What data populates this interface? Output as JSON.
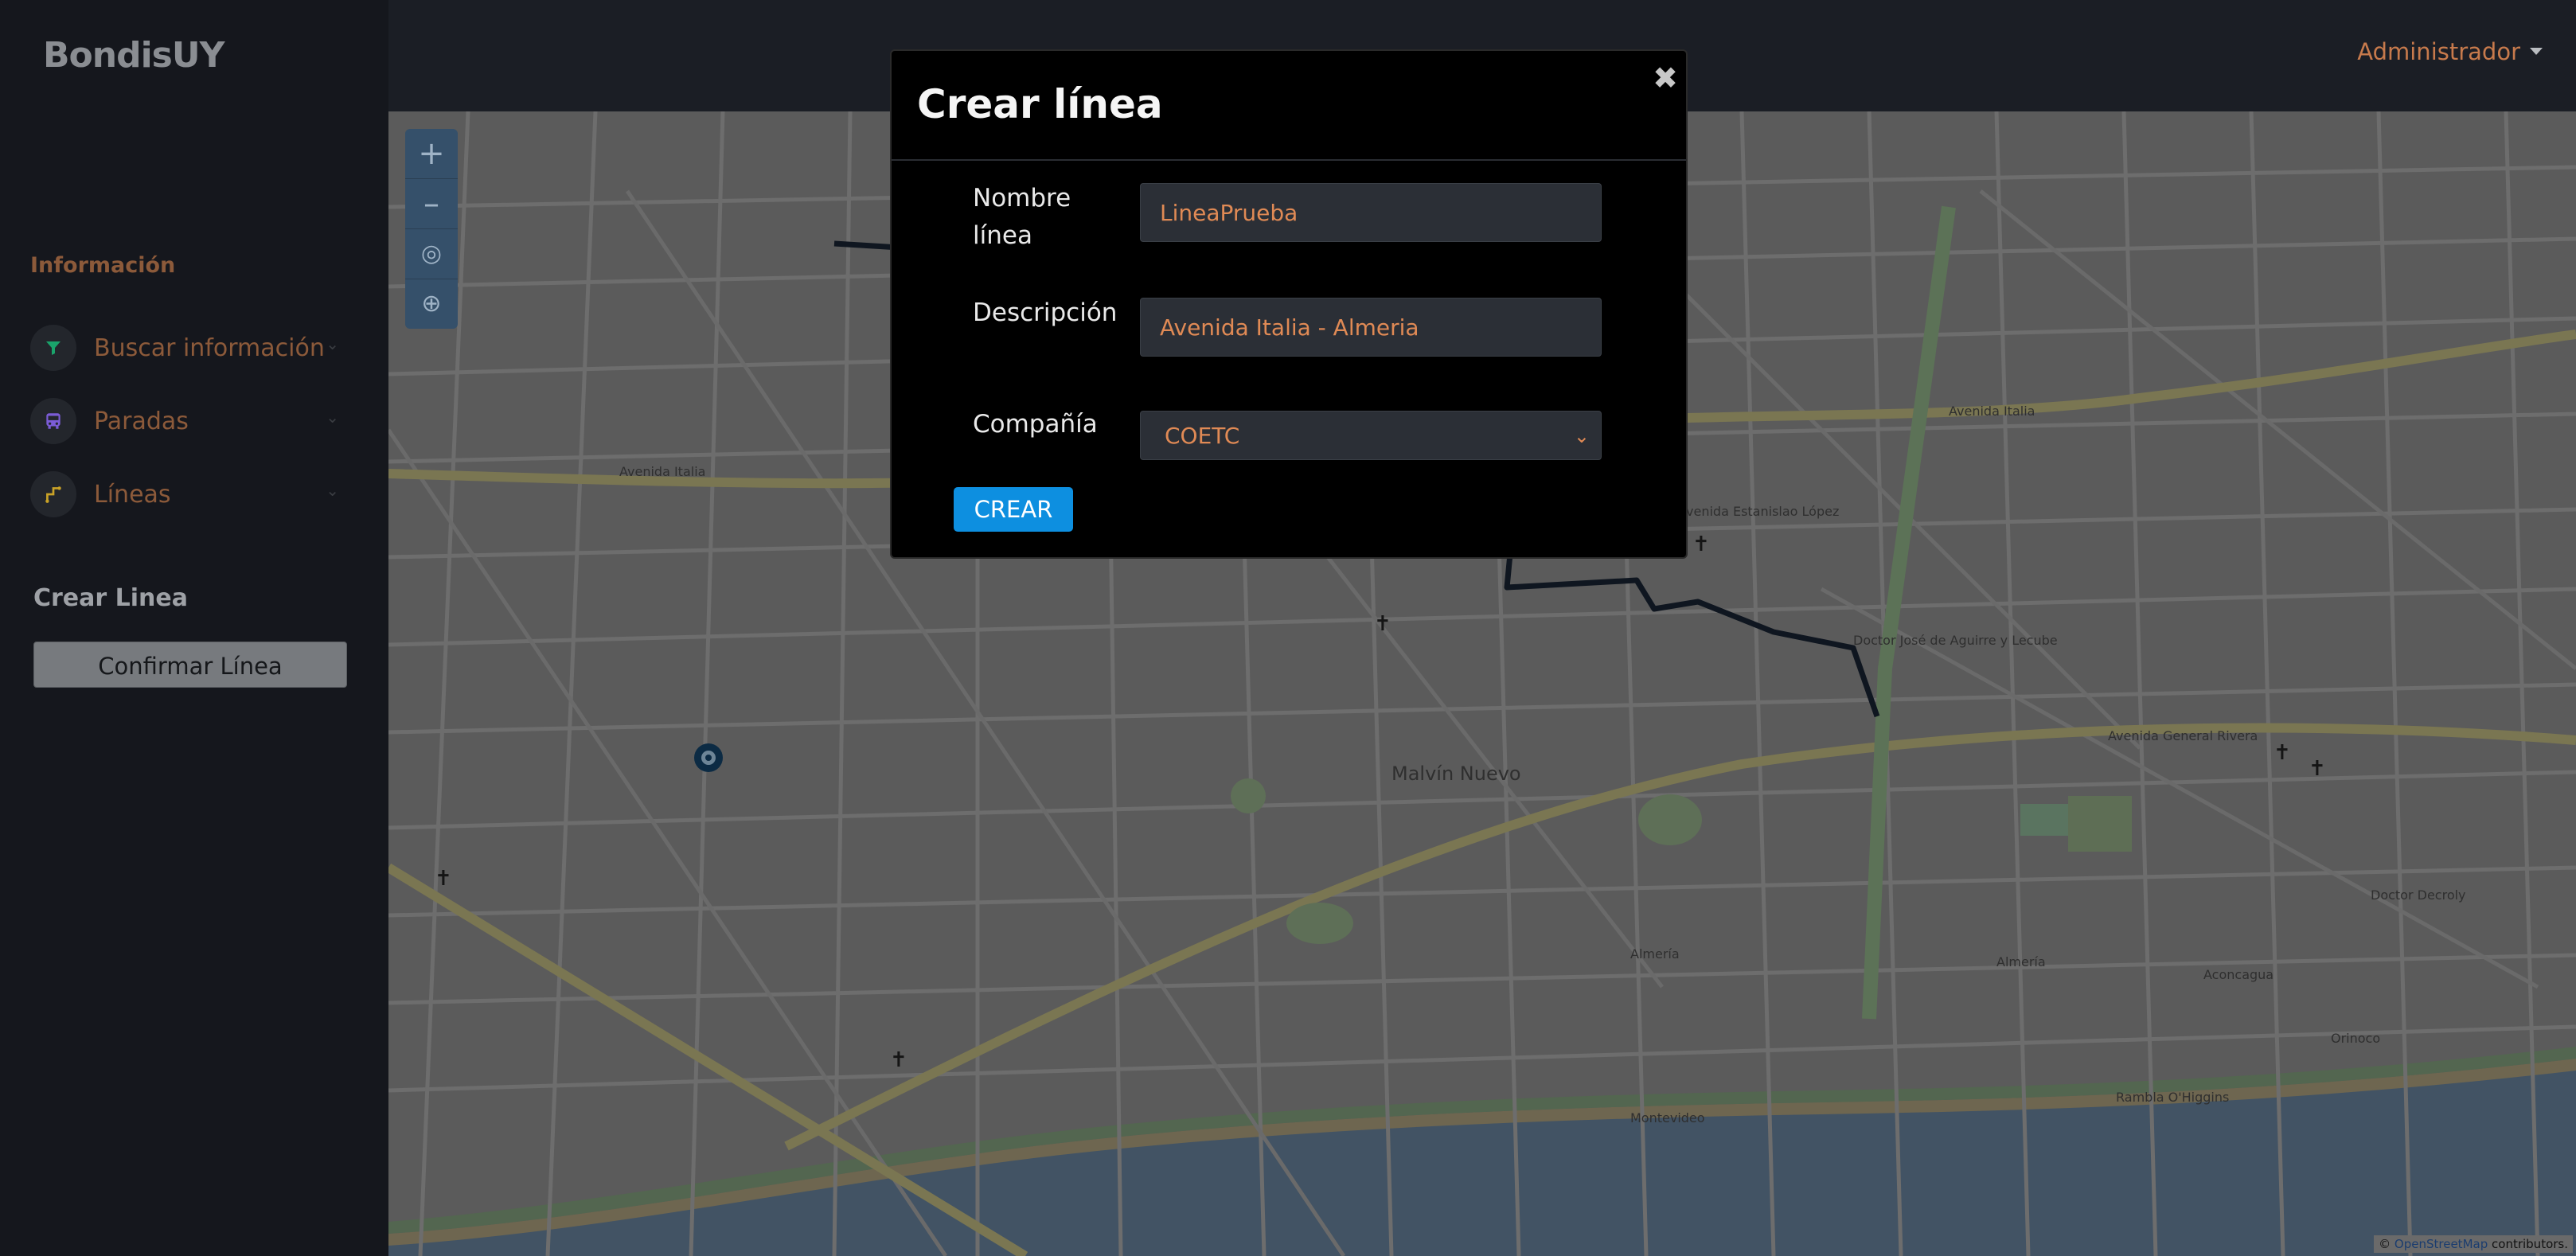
{
  "sidebar": {
    "brand": "BondisUY",
    "section_title": "Información",
    "items": [
      {
        "label": "Buscar información",
        "icon": "filter-icon",
        "color": "#1aa36b"
      },
      {
        "label": "Paradas",
        "icon": "bus-icon",
        "color": "#7b5cd6"
      },
      {
        "label": "Líneas",
        "icon": "route-icon",
        "color": "#c9a227"
      }
    ],
    "crear_title": "Crear Linea",
    "confirm_label": "Confirmar Línea"
  },
  "topbar": {
    "user": "Administrador"
  },
  "map": {
    "zoom_in": "+",
    "zoom_out": "–",
    "attribution_prefix": "©",
    "attribution_link": "OpenStreetMap",
    "attribution_suffix": "contributors."
  },
  "modal": {
    "title": "Crear línea",
    "close": "✖",
    "fields": {
      "nombre_label": "Nombre línea",
      "nombre_value": "LineaPrueba",
      "descripcion_label": "Descripción",
      "descripcion_value": "Avenida Italia - Almeria",
      "compania_label": "Compañía",
      "compania_value": "COETC"
    },
    "submit": "CREAR"
  },
  "colors": {
    "accent": "#c77a4c",
    "button_primary": "#0d8fe0",
    "route_line": "#0f1620"
  }
}
